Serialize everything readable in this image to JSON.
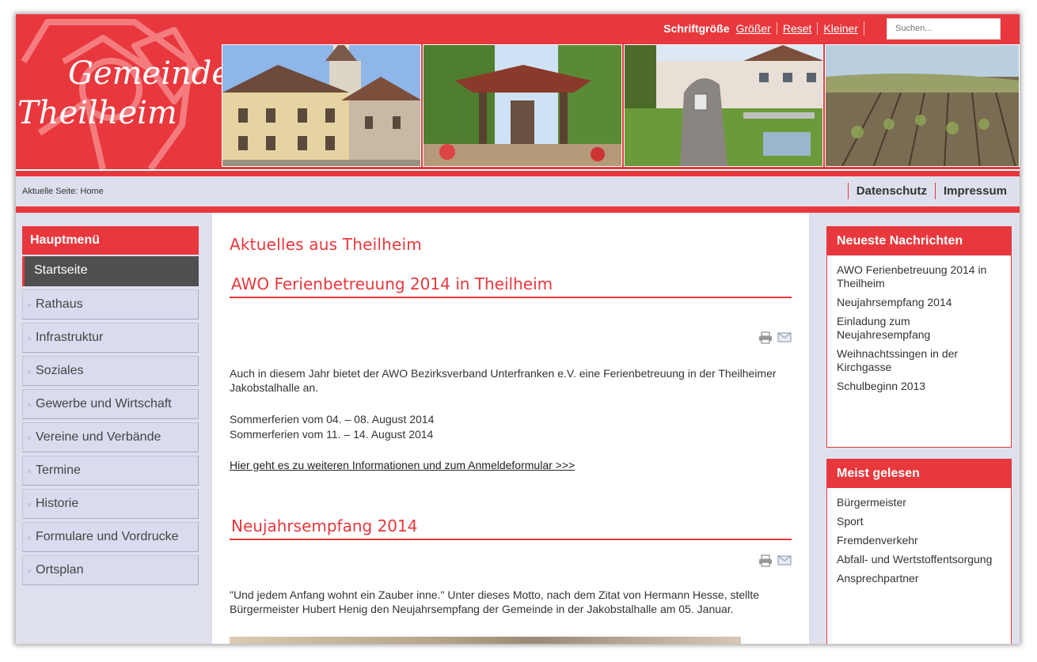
{
  "header": {
    "logo_line1": "Gemeinde",
    "logo_line2": "Theilheim",
    "font_size_label": "Schriftgröße",
    "font_links": [
      "Größer",
      "Reset",
      "Kleiner"
    ],
    "search_placeholder": "Suchen..."
  },
  "breadcrumb": "Aktuelle Seite: Home",
  "top_links": [
    "Datenschutz",
    "Impressum"
  ],
  "left_menu": {
    "title": "Hauptmenü",
    "items": [
      "Startseite",
      "Rathaus",
      "Infrastruktur",
      "Soziales",
      "Gewerbe und Wirtschaft",
      "Vereine und Verbände",
      "Termine",
      "Historie",
      "Formulare und Vordrucke",
      "Ortsplan"
    ],
    "active_index": 0
  },
  "main": {
    "page_title": "Aktuelles aus Theilheim",
    "articles": [
      {
        "title": "AWO Ferienbetreuung 2014 in Theilheim",
        "intro": "Auch in diesem Jahr bietet der AWO Bezirksverband Unterfranken e.V. eine Ferienbetreuung in der Theilheimer Jakobstalhalle an.",
        "dates_line1": "Sommerferien vom 04.  – 08. August 2014",
        "dates_line2": "Sommerferien vom 11. – 14. August 2014",
        "link": "Hier geht es zu weiteren Informationen und zum Anmeldeformular >>>"
      },
      {
        "title": "Neujahrsempfang 2014",
        "intro": "\"Und jedem Anfang wohnt ein Zauber inne.\" Unter dieses Motto, nach dem Zitat von Hermann Hesse, stellte Bürgermeister Hubert Henig den Neujahrsempfang der Gemeinde in der Jakobstalhalle am 05. Januar."
      }
    ]
  },
  "right": {
    "news_title": "Neueste Nachrichten",
    "news": [
      "AWO Ferienbetreuung 2014 in Theilheim",
      "Neujahrsempfang 2014",
      "Einladung zum Neujahresempfang",
      "Weihnachtssingen in der Kirchgasse",
      "Schulbeginn 2013"
    ],
    "popular_title": "Meist gelesen",
    "popular": [
      "Bürgermeister",
      "Sport",
      "Fremdenverkehr",
      "Abfall- und Wertstoffentsorgung",
      "Ansprechpartner"
    ]
  },
  "colors": {
    "brand_red": "#e8383d",
    "panel": "#dfe0ee",
    "active_menu": "#4f4f4f"
  }
}
